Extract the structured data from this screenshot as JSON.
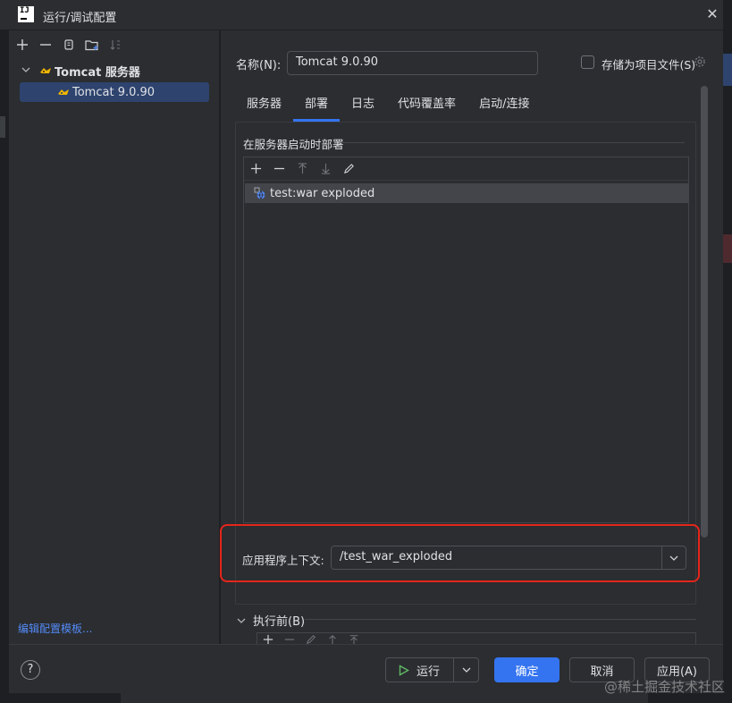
{
  "window": {
    "title": "运行/调试配置"
  },
  "sidebar": {
    "group_label": "Tomcat 服务器",
    "item_label": "Tomcat 9.0.90",
    "edit_templates_link": "编辑配置模板..."
  },
  "config": {
    "name_label": "名称(N):",
    "name_value": "Tomcat 9.0.90",
    "store_as_project_file_label": "存储为项目文件(S)",
    "store_as_project_file_checked": false
  },
  "tabs": [
    {
      "label": "服务器",
      "active": false
    },
    {
      "label": "部署",
      "active": true
    },
    {
      "label": "日志",
      "active": false
    },
    {
      "label": "代码覆盖率",
      "active": false
    },
    {
      "label": "启动/连接",
      "active": false
    }
  ],
  "deployment": {
    "section_title": "在服务器启动时部署",
    "artifacts": [
      "test:war exploded"
    ],
    "app_context_label": "应用程序上下文:",
    "app_context_value": "/test_war_exploded"
  },
  "before_launch": {
    "label": "执行前(B)"
  },
  "footer": {
    "help_label": "?",
    "run_label": "运行",
    "ok_label": "确定",
    "cancel_label": "取消",
    "apply_label": "应用(A)"
  },
  "watermark": "@稀土掘金技术社区",
  "colors": {
    "accent": "#3574f0",
    "highlight_border": "#e5251b",
    "link": "#548af7",
    "selection": "#2e436e"
  }
}
